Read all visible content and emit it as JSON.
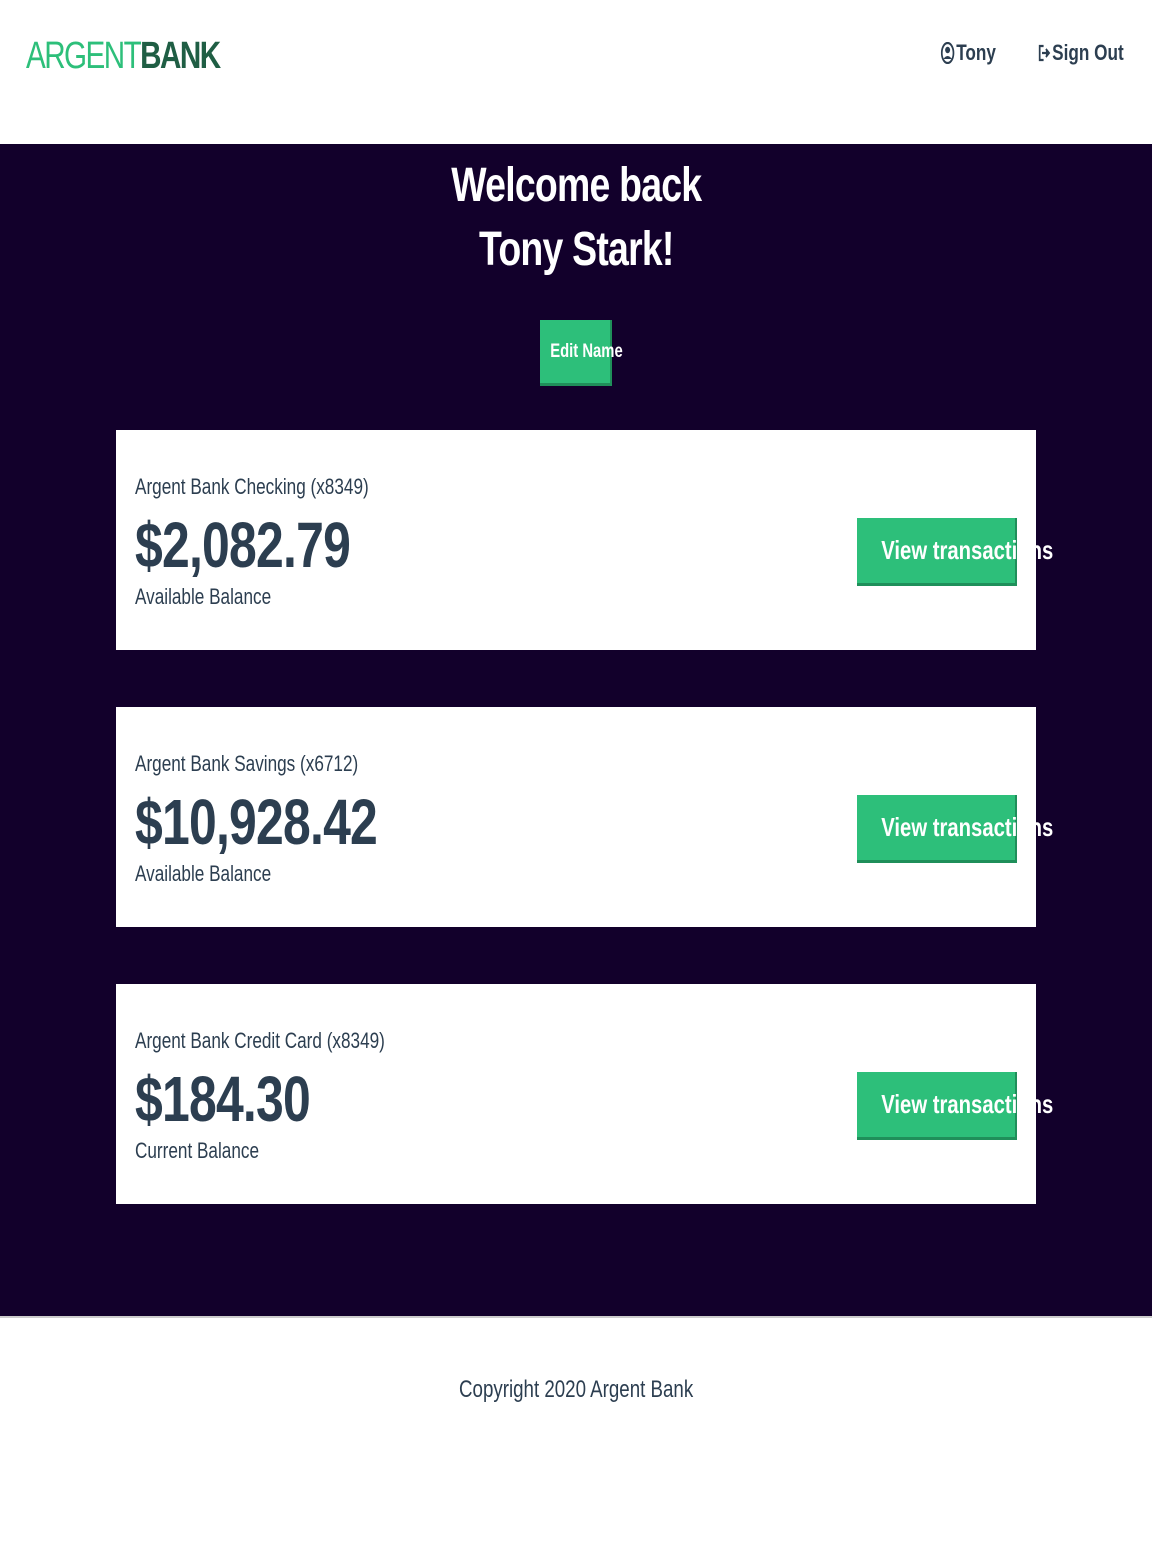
{
  "nav": {
    "logo_part1": "ARGENT",
    "logo_part2": "BANK",
    "user_link": "Tony",
    "user_icon": "user-circle-icon",
    "signout_link": "Sign Out",
    "signout_icon": "sign-out-icon"
  },
  "header": {
    "welcome_line1": "Welcome back",
    "welcome_line2": "Tony Stark!",
    "edit_button": "Edit Name"
  },
  "accounts": [
    {
      "title": "Argent Bank Checking (x8349)",
      "amount": "$2,082.79",
      "description": "Available Balance",
      "button": "View transactions"
    },
    {
      "title": "Argent Bank Savings (x6712)",
      "amount": "$10,928.42",
      "description": "Available Balance",
      "button": "View transactions"
    },
    {
      "title": "Argent Bank Credit Card (x8349)",
      "amount": "$184.30",
      "description": "Current Balance",
      "button": "View transactions"
    }
  ],
  "footer": {
    "copyright": "Copyright 2020 Argent Bank"
  },
  "colors": {
    "brand_green": "#2dbf7a",
    "brand_dark_green": "#1f5e44",
    "main_background": "#12002b",
    "text_dark": "#2c3e50"
  }
}
